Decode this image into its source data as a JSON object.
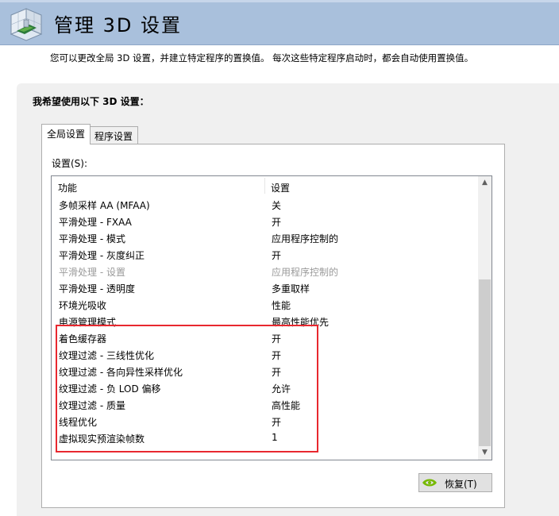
{
  "header": {
    "title": "管理 3D 设置",
    "logo_icon": "nvidia-3d-settings-icon"
  },
  "description": "您可以更改全局 3D 设置，并建立特定程序的置换值。 每次这些特定程序启动时，都会自动使用置换值。",
  "panel_heading": "我希望使用以下 3D 设置：",
  "tabs": [
    {
      "label": "全局设置",
      "active": true
    },
    {
      "label": "程序设置",
      "active": false
    }
  ],
  "settings_label": "设置(S):",
  "columns": {
    "feature": "功能",
    "setting": "设置"
  },
  "rows": [
    {
      "feature": "多帧采样 AA (MFAA)",
      "value": "关",
      "disabled": false
    },
    {
      "feature": "平滑处理 - FXAA",
      "value": "开",
      "disabled": false
    },
    {
      "feature": "平滑处理 - 模式",
      "value": "应用程序控制的",
      "disabled": false
    },
    {
      "feature": "平滑处理 - 灰度纠正",
      "value": "开",
      "disabled": false
    },
    {
      "feature": "平滑处理 - 设置",
      "value": "应用程序控制的",
      "disabled": true
    },
    {
      "feature": "平滑处理 - 透明度",
      "value": "多重取样",
      "disabled": false
    },
    {
      "feature": "环境光吸收",
      "value": "性能",
      "disabled": false
    },
    {
      "feature": "电源管理模式",
      "value": "最高性能优先",
      "disabled": false
    },
    {
      "feature": "着色缓存器",
      "value": "开",
      "disabled": false
    },
    {
      "feature": "纹理过滤 - 三线性优化",
      "value": "开",
      "disabled": false
    },
    {
      "feature": "纹理过滤 - 各向异性采样优化",
      "value": "开",
      "disabled": false
    },
    {
      "feature": "纹理过滤 - 负 LOD 偏移",
      "value": "允许",
      "disabled": false
    },
    {
      "feature": "纹理过滤 - 质量",
      "value": "高性能",
      "disabled": false
    },
    {
      "feature": "线程优化",
      "value": "开",
      "disabled": false
    },
    {
      "feature": "虚拟现实预渲染帧数",
      "value": "1",
      "disabled": false
    }
  ],
  "restore_button": {
    "label": "恢复(T)",
    "icon": "nvidia-eye-icon"
  },
  "colors": {
    "header_bg": "#a9c0dc",
    "highlight_border": "#e8282f",
    "nvidia_green": "#76b900"
  }
}
